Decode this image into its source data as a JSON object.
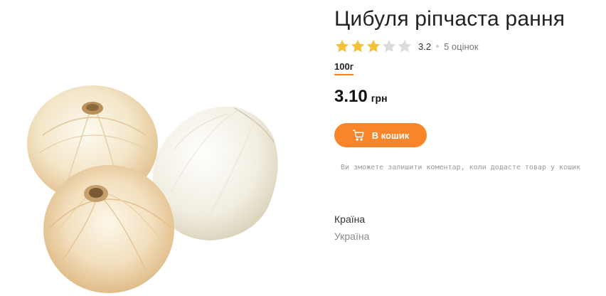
{
  "product": {
    "title": "Цибуля ріпчаста рання",
    "rating": {
      "value": 3.2,
      "value_label": "3.2",
      "stars_filled": 3,
      "stars_total": 5,
      "count_label": "5 оцінок"
    },
    "weight_option": "100г",
    "price": {
      "value": "3.10",
      "unit": "грн"
    },
    "add_to_cart_label": "В кошик",
    "comment_note": "Ви зможете залишити коментар, коли додасте товар у кошик",
    "attributes": [
      {
        "label": "Країна",
        "value": "Україна"
      }
    ],
    "image": "onion-product-image"
  },
  "colors": {
    "accent": "#f8852a",
    "star_filled": "#f3c13a",
    "star_empty": "#dcdcdc",
    "muted_text": "#8a8a8a"
  },
  "icons": {
    "cart": "cart-icon",
    "star": "star-icon"
  }
}
